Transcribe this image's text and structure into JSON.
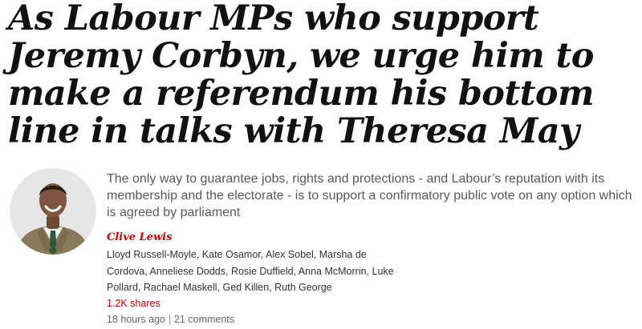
{
  "article": {
    "headline": "As Labour MPs who support Jeremy Corbyn, we urge him to make a referendum his bottom line in talks with Theresa May",
    "standfirst": "The only way to guarantee jobs, rights and protections - and Labour’s reputation with its membership and the electorate - is to support a confirmatory public vote on any option which is agreed by parliament",
    "byline": {
      "author": "Clive Lewis",
      "coauthors": "Lloyd Russell-Moyle, Kate Osamor, Alex Sobel, Marsha de Cordova, Anneliese Dodds, Rosie Duffield, Anna McMorrin, Luke Pollard, Rachael Maskell, Ged Killen, Ruth George"
    },
    "shares": "1.2K shares",
    "published": "18 hours ago",
    "comments": "21 comments"
  },
  "colors": {
    "accent": "#c70000",
    "headline": "#121212",
    "standfirst": "#595959",
    "meta": "#666666"
  },
  "icons": {
    "author_photo": "author-avatar"
  }
}
